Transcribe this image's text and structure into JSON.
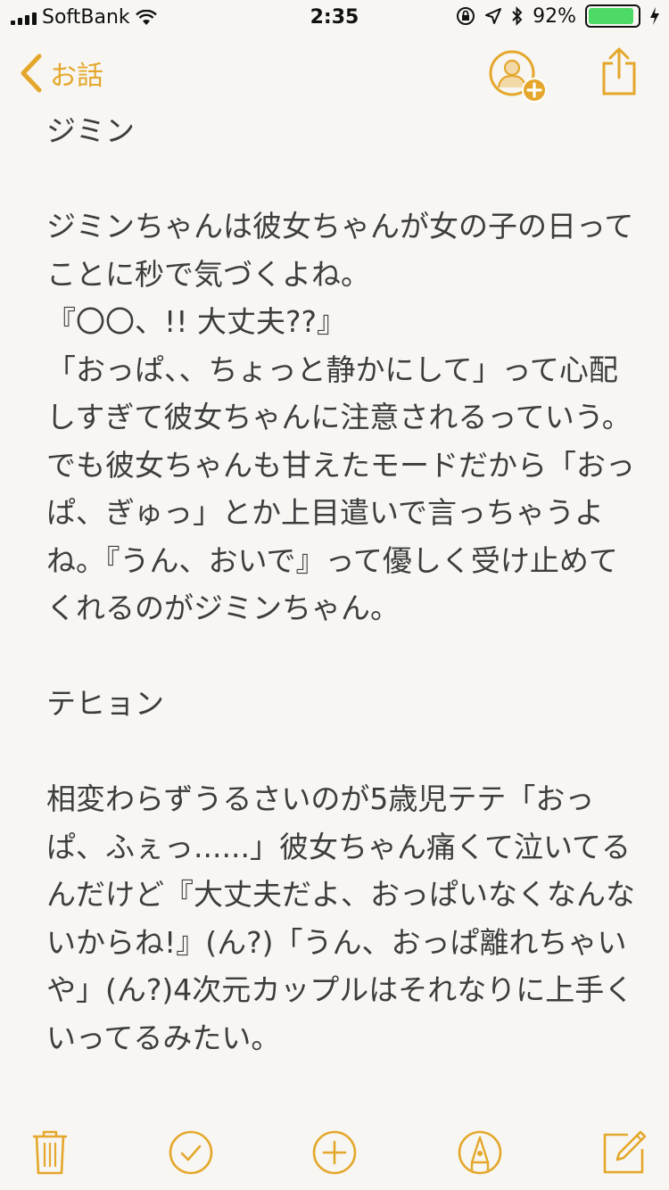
{
  "status_bar": {
    "carrier": "SoftBank",
    "time": "2:35",
    "battery_percent": "92%",
    "battery_level": 0.92,
    "icons": [
      "signal-icon",
      "wifi-icon",
      "orientation-lock-icon",
      "location-icon",
      "bluetooth-icon",
      "battery-icon",
      "charging-icon"
    ]
  },
  "nav": {
    "back_label": "お話",
    "icons": [
      "chevron-left-icon",
      "add-person-icon",
      "share-icon"
    ]
  },
  "note": {
    "paragraphs": [
      "ジミン",
      "",
      "ジミンちゃんは彼女ちゃんが女の子の日ってことに秒で気づくよね。\n『〇〇、!! 大丈夫??』\n「おっぱ、、ちょっと静かにして」って心配しすぎて彼女ちゃんに注意されるっていう。でも彼女ちゃんも甘えたモードだから「おっぱ、ぎゅっ」とか上目遣いで言っちゃうよね。『うん、おいで』って優しく受け止めてくれるのがジミンちゃん。",
      "",
      "テヒョン",
      "",
      "相変わらずうるさいのが5歳児テテ「おっぱ、ふぇっ......」彼女ちゃん痛くて泣いてるんだけど『大丈夫だよ、おっぱいなくなんないからね!』(ん?)「うん、おっぱ離れちゃいや」(ん?)4次元カップルはそれなりに上手くいってるみたい。"
    ]
  },
  "toolbar": {
    "icons": [
      "trash-icon",
      "checklist-icon",
      "add-icon",
      "markup-icon",
      "compose-icon"
    ]
  },
  "colors": {
    "accent": "#e4a72b",
    "background": "#f7f6f2",
    "text": "#3d3d3d",
    "battery": "#4cd964"
  }
}
